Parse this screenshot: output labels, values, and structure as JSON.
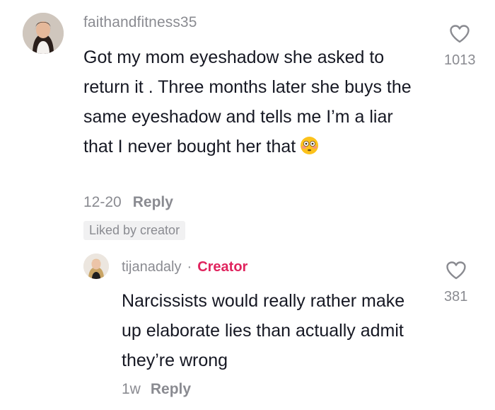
{
  "comment": {
    "username": "faithandfitness35",
    "text": "Got my mom eyeshadow she asked to return it . Three months later she buys the same eyeshadow and tells me I’m a liar that I never bought her that",
    "emoji": "flushed-face-emoji",
    "date": "12-20",
    "reply_label": "Reply",
    "liked_badge": "Liked by creator",
    "like_count": "1013"
  },
  "reply": {
    "username": "tijanadaly",
    "separator": "·",
    "creator_label": "Creator",
    "text": "Narcissists would really rather make up elaborate lies than actually admit they’re wrong",
    "time": "1w",
    "reply_label": "Reply",
    "like_count": "381"
  },
  "colors": {
    "muted": "#8a8b91",
    "text": "#161823",
    "creator": "#e0245e",
    "badge_bg": "#f1f1f2"
  }
}
